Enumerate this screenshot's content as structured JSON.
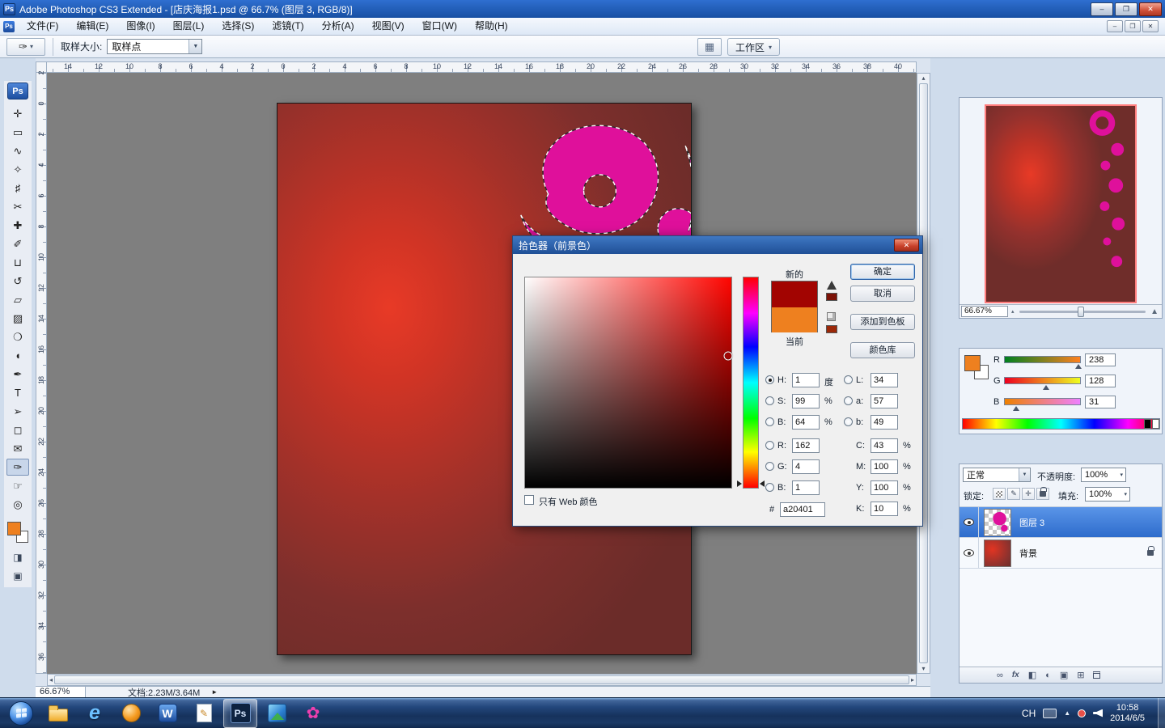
{
  "titlebar": {
    "app_badge": "Ps",
    "title": "Adobe Photoshop CS3 Extended - [店庆海报1.psd @ 66.7% (图层 3, RGB/8)]"
  },
  "icons": {
    "minimize": "–",
    "maximize": "❐",
    "close": "✕",
    "menu_min": "–",
    "menu_restore": "❐",
    "menu_close": "✕",
    "dropdown": "▼",
    "small_down": "▾",
    "bridge": "▦",
    "quick_mask": "◨",
    "screen_mode": "▣",
    "status_arrow": "►",
    "tray_hidden": "▲",
    "scroll_left": "◂",
    "scroll_right": "▸",
    "scroll_up": "▴",
    "scroll_down": "▾",
    "mountain_small": "▴",
    "mountain_large": "▲"
  },
  "menubar": {
    "items": [
      "文件(F)",
      "编辑(E)",
      "图像(I)",
      "图层(L)",
      "选择(S)",
      "滤镜(T)",
      "分析(A)",
      "视图(V)",
      "窗口(W)",
      "帮助(H)"
    ]
  },
  "options_bar": {
    "tool_glyph": "✑",
    "sample_size_label": "取样大小:",
    "sample_size_value": "取样点",
    "workspace_label": "工作区"
  },
  "toolbox": {
    "badge": "Ps",
    "tools": [
      {
        "name": "move",
        "glyph": "✛"
      },
      {
        "name": "rectangular-marquee",
        "glyph": "▭"
      },
      {
        "name": "lasso",
        "glyph": "∿"
      },
      {
        "name": "quick-selection",
        "glyph": "✧"
      },
      {
        "name": "crop",
        "glyph": "♯"
      },
      {
        "name": "slice",
        "glyph": "✂"
      },
      {
        "name": "spot-healing",
        "glyph": "✚"
      },
      {
        "name": "brush",
        "glyph": "✐"
      },
      {
        "name": "clone-stamp",
        "glyph": "⊔"
      },
      {
        "name": "history-brush",
        "glyph": "↺"
      },
      {
        "name": "eraser",
        "glyph": "▱"
      },
      {
        "name": "gradient",
        "glyph": "▨"
      },
      {
        "name": "blur",
        "glyph": "❍"
      },
      {
        "name": "dodge",
        "glyph": "◖"
      },
      {
        "name": "pen",
        "glyph": "✒"
      },
      {
        "name": "type",
        "glyph": "T"
      },
      {
        "name": "path-selection",
        "glyph": "➢"
      },
      {
        "name": "shape",
        "glyph": "◻"
      },
      {
        "name": "notes",
        "glyph": "✉"
      },
      {
        "name": "eyedropper",
        "glyph": "✑",
        "active": true
      },
      {
        "name": "hand",
        "glyph": "☞"
      },
      {
        "name": "zoom",
        "glyph": "◎"
      }
    ]
  },
  "rulers": {
    "horizontal": [
      "14",
      "12",
      "10",
      "8",
      "6",
      "4",
      "2",
      "0",
      "2",
      "4",
      "6",
      "8",
      "10",
      "12",
      "14",
      "16",
      "18",
      "20",
      "22",
      "24",
      "26",
      "28",
      "30",
      "32",
      "34",
      "36",
      "38",
      "40"
    ],
    "vertical": [
      "2",
      "0",
      "2",
      "4",
      "6",
      "8",
      "10",
      "12",
      "14",
      "16",
      "18",
      "20",
      "22",
      "24",
      "26",
      "28",
      "30",
      "32",
      "34",
      "36"
    ]
  },
  "color_picker": {
    "title": "拾色器（前景色）",
    "new_label": "新的",
    "current_label": "当前",
    "ok": "确定",
    "cancel": "取消",
    "add_to_swatches": "添加到色板",
    "color_libraries": "颜色库",
    "web_only": "只有 Web 颜色",
    "hex_label": "#",
    "hex_value": "a20401",
    "new_color": "#a20401",
    "current_color": "#ee801f",
    "hsb": [
      {
        "id": "h",
        "label": "H:",
        "value": "1",
        "unit": "度",
        "radio": true,
        "checked": true
      },
      {
        "id": "s",
        "label": "S:",
        "value": "99",
        "unit": "%",
        "radio": true
      },
      {
        "id": "b",
        "label": "B:",
        "value": "64",
        "unit": "%",
        "radio": true
      }
    ],
    "rgb": [
      {
        "id": "r",
        "label": "R:",
        "value": "162",
        "radio": true
      },
      {
        "id": "g",
        "label": "G:",
        "value": "4",
        "radio": true
      },
      {
        "id": "b2",
        "label": "B:",
        "value": "1",
        "radio": true
      }
    ],
    "lab": [
      {
        "id": "l",
        "label": "L:",
        "value": "34",
        "radio": true
      },
      {
        "id": "a",
        "label": "a:",
        "value": "57",
        "radio": true
      },
      {
        "id": "bb",
        "label": "b:",
        "value": "49",
        "radio": true
      }
    ],
    "cmyk": [
      {
        "id": "c",
        "label": "C:",
        "value": "43",
        "unit": "%"
      },
      {
        "id": "m",
        "label": "M:",
        "value": "100",
        "unit": "%"
      },
      {
        "id": "y",
        "label": "Y:",
        "value": "100",
        "unit": "%"
      },
      {
        "id": "k",
        "label": "K:",
        "value": "10",
        "unit": "%"
      }
    ]
  },
  "navigator": {
    "zoom": "66.67%"
  },
  "color_panel": {
    "channels": [
      {
        "label": "R",
        "value": "238"
      },
      {
        "label": "G",
        "value": "128"
      },
      {
        "label": "B",
        "value": "31"
      }
    ],
    "foreground": "#ee801f"
  },
  "layers_panel": {
    "blend_mode": "正常",
    "opacity_label": "不透明度:",
    "opacity_value": "100%",
    "lock_label": "锁定:",
    "fill_label": "填充:",
    "fill_value": "100%",
    "layers": [
      {
        "name": "图层 3",
        "selected": true,
        "thumb": "checker-swirl"
      },
      {
        "name": "背景",
        "locked": true,
        "thumb": "red-grad"
      }
    ]
  },
  "status_bar": {
    "zoom": "66.67%",
    "doc_info": "文档:2.23M/3.64M"
  },
  "taskbar": {
    "apps": [
      {
        "name": "explorer"
      },
      {
        "name": "ie",
        "glyph": "e"
      },
      {
        "name": "browser"
      },
      {
        "name": "word",
        "glyph": "W"
      },
      {
        "name": "notepad",
        "glyph": "✎"
      },
      {
        "name": "photoshop",
        "glyph": "Ps",
        "active": true
      },
      {
        "name": "viewer"
      },
      {
        "name": "flower",
        "glyph": "✿"
      }
    ],
    "tray": {
      "lang": "CH",
      "time": "10:58",
      "date": "2014/6/5"
    }
  },
  "colors": {
    "selection_blue": "#2e6ccc",
    "ornament_magenta": "#df109b",
    "poster_bright": "#e83a26",
    "poster_dark": "#6b2c29"
  }
}
